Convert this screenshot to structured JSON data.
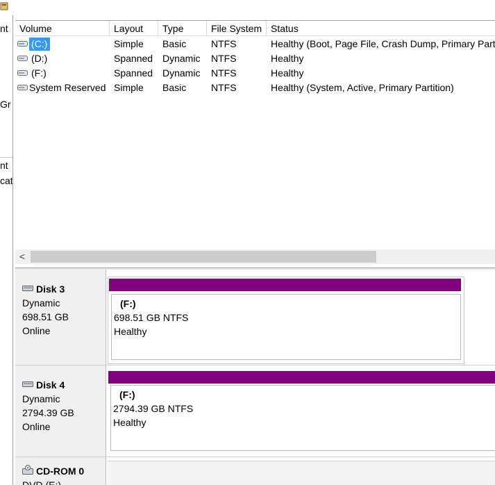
{
  "left_pane": {
    "fragments": [
      "nt",
      "Gr",
      "nt",
      "cat"
    ]
  },
  "volume_list": {
    "columns": [
      "Volume",
      "Layout",
      "Type",
      "File System",
      "Status"
    ],
    "rows": [
      {
        "volume": "(C:)",
        "layout": "Simple",
        "type": "Basic",
        "fs": "NTFS",
        "status": "Healthy (Boot, Page File, Crash Dump, Primary Partition)",
        "icon": "drive-icon",
        "selected": true
      },
      {
        "volume": "(D:)",
        "layout": "Spanned",
        "type": "Dynamic",
        "fs": "NTFS",
        "status": "Healthy",
        "icon": "drive-icon",
        "selected": false
      },
      {
        "volume": "(F:)",
        "layout": "Spanned",
        "type": "Dynamic",
        "fs": "NTFS",
        "status": "Healthy",
        "icon": "drive-icon",
        "selected": false
      },
      {
        "volume": "System Reserved",
        "layout": "Simple",
        "type": "Basic",
        "fs": "NTFS",
        "status": "Healthy (System, Active, Primary Partition)",
        "icon": "drive-icon",
        "selected": false
      }
    ],
    "scroll_left_glyph": "<"
  },
  "disks": [
    {
      "name": "Disk 3",
      "kind": "Dynamic",
      "size": "698.51 GB",
      "state": "Online",
      "partition": {
        "name": "(F:)",
        "size_fs": "698.51 GB NTFS",
        "status": "Healthy"
      }
    },
    {
      "name": "Disk 4",
      "kind": "Dynamic",
      "size": "2794.39 GB",
      "state": "Online",
      "partition": {
        "name": "(F:)",
        "size_fs": "2794.39 GB NTFS",
        "status": "Healthy"
      }
    },
    {
      "name": "CD-ROM 0",
      "kind": "DVD (E:)"
    }
  ],
  "colors": {
    "spanned_volume": "#800080",
    "selection": "#3399ff"
  }
}
